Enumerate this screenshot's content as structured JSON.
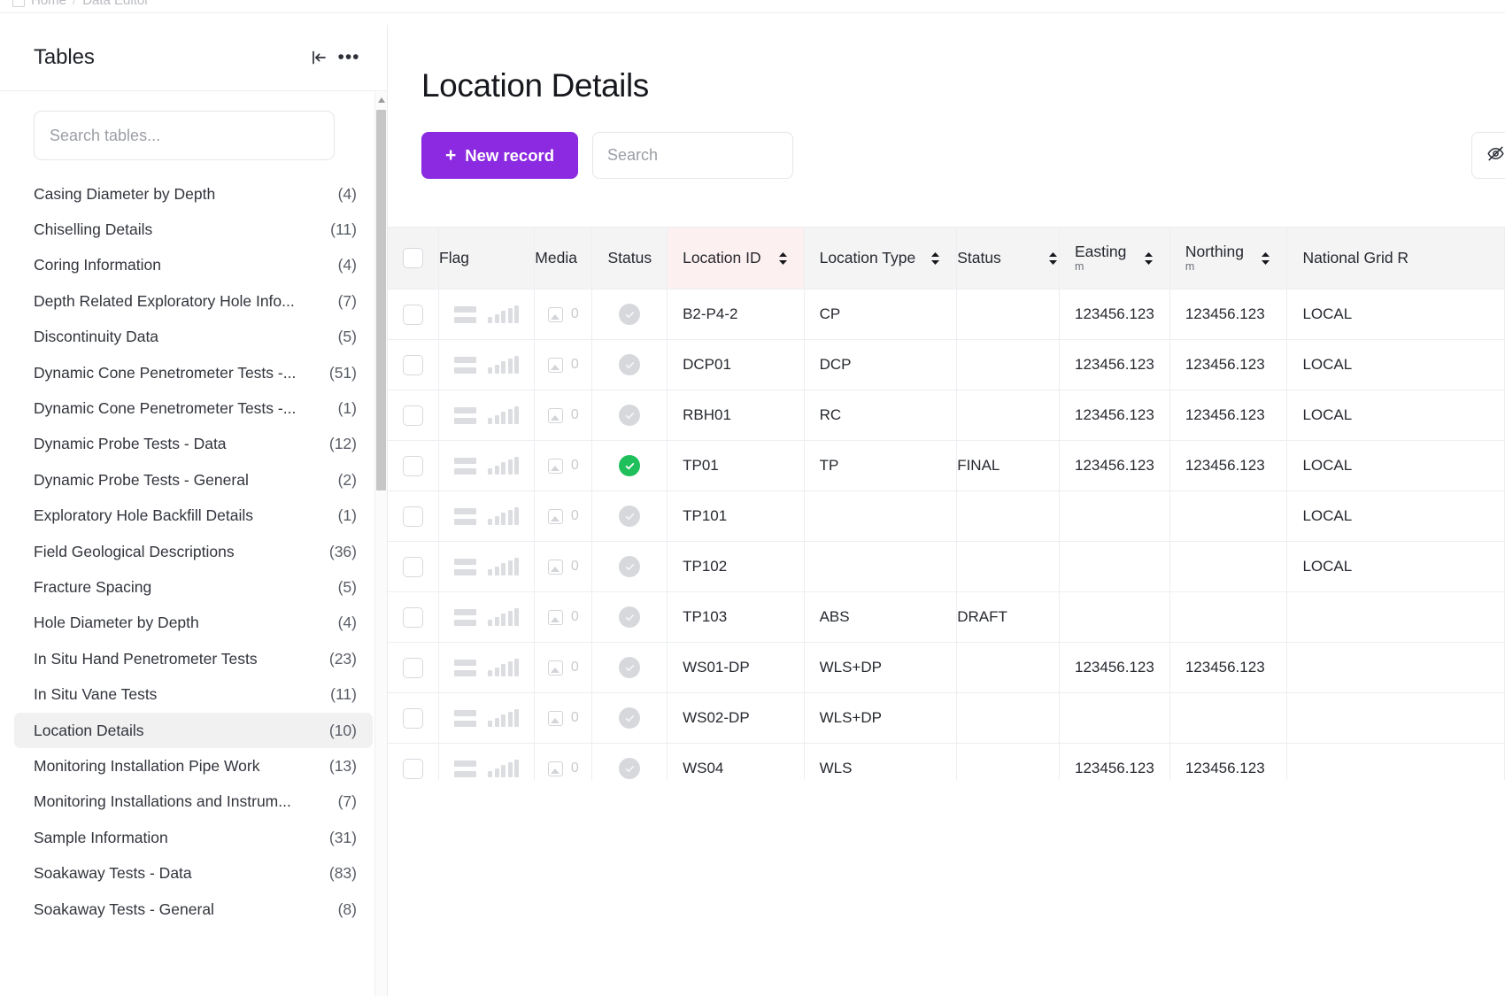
{
  "breadcrumb": {
    "home_label": "Home",
    "separator": "/",
    "current_label": "Data Editor"
  },
  "sidebar": {
    "title": "Tables",
    "collapse_icon": "collapse-left-icon",
    "more_icon": "ellipsis-icon",
    "search_placeholder": "Search tables...",
    "search_value": "",
    "items": [
      {
        "label": "Casing Diameter by Depth",
        "count": "(4)",
        "active": false
      },
      {
        "label": "Chiselling Details",
        "count": "(11)",
        "active": false
      },
      {
        "label": "Coring Information",
        "count": "(4)",
        "active": false
      },
      {
        "label": "Depth Related Exploratory Hole Info...",
        "count": "(7)",
        "active": false
      },
      {
        "label": "Discontinuity Data",
        "count": "(5)",
        "active": false
      },
      {
        "label": "Dynamic Cone Penetrometer Tests -...",
        "count": "(51)",
        "active": false
      },
      {
        "label": "Dynamic Cone Penetrometer Tests -...",
        "count": "(1)",
        "active": false
      },
      {
        "label": "Dynamic Probe Tests - Data",
        "count": "(12)",
        "active": false
      },
      {
        "label": "Dynamic Probe Tests - General",
        "count": "(2)",
        "active": false
      },
      {
        "label": "Exploratory Hole Backfill Details",
        "count": "(1)",
        "active": false
      },
      {
        "label": "Field Geological Descriptions",
        "count": "(36)",
        "active": false
      },
      {
        "label": "Fracture Spacing",
        "count": "(5)",
        "active": false
      },
      {
        "label": "Hole Diameter by Depth",
        "count": "(4)",
        "active": false
      },
      {
        "label": "In Situ Hand Penetrometer Tests",
        "count": "(23)",
        "active": false
      },
      {
        "label": "In Situ Vane Tests",
        "count": "(11)",
        "active": false
      },
      {
        "label": "Location Details",
        "count": "(10)",
        "active": true
      },
      {
        "label": "Monitoring Installation Pipe Work",
        "count": "(13)",
        "active": false
      },
      {
        "label": "Monitoring Installations and Instrum...",
        "count": "(7)",
        "active": false
      },
      {
        "label": "Sample Information",
        "count": "(31)",
        "active": false
      },
      {
        "label": "Soakaway Tests - Data",
        "count": "(83)",
        "active": false
      },
      {
        "label": "Soakaway Tests - General",
        "count": "(8)",
        "active": false
      }
    ]
  },
  "main": {
    "page_title": "Location Details",
    "new_record_label": "New record",
    "new_record_plus": "+",
    "search_placeholder": "Search",
    "search_value": "",
    "hide_fields_icon": "eye-off-icon",
    "accent_color": "#8b2ae0",
    "highlight_column_color": "#fdf0f0",
    "status_green": "#1fbf5c"
  },
  "table": {
    "columns": [
      {
        "key": "select",
        "label": "",
        "unit": "",
        "sortable": false,
        "highlight": false
      },
      {
        "key": "flag",
        "label": "Flag",
        "unit": "",
        "sortable": false,
        "highlight": false
      },
      {
        "key": "media",
        "label": "Media",
        "unit": "",
        "sortable": false,
        "highlight": false
      },
      {
        "key": "status_icon",
        "label": "Status",
        "unit": "",
        "sortable": false,
        "highlight": false
      },
      {
        "key": "location_id",
        "label": "Location ID",
        "unit": "",
        "sortable": true,
        "highlight": true
      },
      {
        "key": "location_type",
        "label": "Location Type",
        "unit": "",
        "sortable": true,
        "highlight": false
      },
      {
        "key": "status",
        "label": "Status",
        "unit": "",
        "sortable": true,
        "highlight": false
      },
      {
        "key": "easting",
        "label": "Easting",
        "unit": "m",
        "sortable": true,
        "highlight": false
      },
      {
        "key": "northing",
        "label": "Northing",
        "unit": "m",
        "sortable": true,
        "highlight": false
      },
      {
        "key": "national_grid",
        "label": "National Grid R",
        "unit": "",
        "sortable": false,
        "highlight": false
      }
    ],
    "rows": [
      {
        "media_count": "0",
        "status_done": false,
        "location_id": "B2-P4-2",
        "location_type": "CP",
        "status": "",
        "easting": "123456.123",
        "northing": "123456.123",
        "national_grid": "LOCAL"
      },
      {
        "media_count": "0",
        "status_done": false,
        "location_id": "DCP01",
        "location_type": "DCP",
        "status": "",
        "easting": "123456.123",
        "northing": "123456.123",
        "national_grid": "LOCAL"
      },
      {
        "media_count": "0",
        "status_done": false,
        "location_id": "RBH01",
        "location_type": "RC",
        "status": "",
        "easting": "123456.123",
        "northing": "123456.123",
        "national_grid": "LOCAL"
      },
      {
        "media_count": "0",
        "status_done": true,
        "location_id": "TP01",
        "location_type": "TP",
        "status": "FINAL",
        "easting": "123456.123",
        "northing": "123456.123",
        "national_grid": "LOCAL"
      },
      {
        "media_count": "0",
        "status_done": false,
        "location_id": "TP101",
        "location_type": "",
        "status": "",
        "easting": "",
        "northing": "",
        "national_grid": "LOCAL"
      },
      {
        "media_count": "0",
        "status_done": false,
        "location_id": "TP102",
        "location_type": "",
        "status": "",
        "easting": "",
        "northing": "",
        "national_grid": "LOCAL"
      },
      {
        "media_count": "0",
        "status_done": false,
        "location_id": "TP103",
        "location_type": "ABS",
        "status": "DRAFT",
        "easting": "",
        "northing": "",
        "national_grid": ""
      },
      {
        "media_count": "0",
        "status_done": false,
        "location_id": "WS01-DP",
        "location_type": "WLS+DP",
        "status": "",
        "easting": "123456.123",
        "northing": "123456.123",
        "national_grid": ""
      },
      {
        "media_count": "0",
        "status_done": false,
        "location_id": "WS02-DP",
        "location_type": "WLS+DP",
        "status": "",
        "easting": "",
        "northing": "",
        "national_grid": ""
      },
      {
        "media_count": "0",
        "status_done": false,
        "location_id": "WS04",
        "location_type": "WLS",
        "status": "",
        "easting": "123456.123",
        "northing": "123456.123",
        "national_grid": ""
      }
    ]
  }
}
